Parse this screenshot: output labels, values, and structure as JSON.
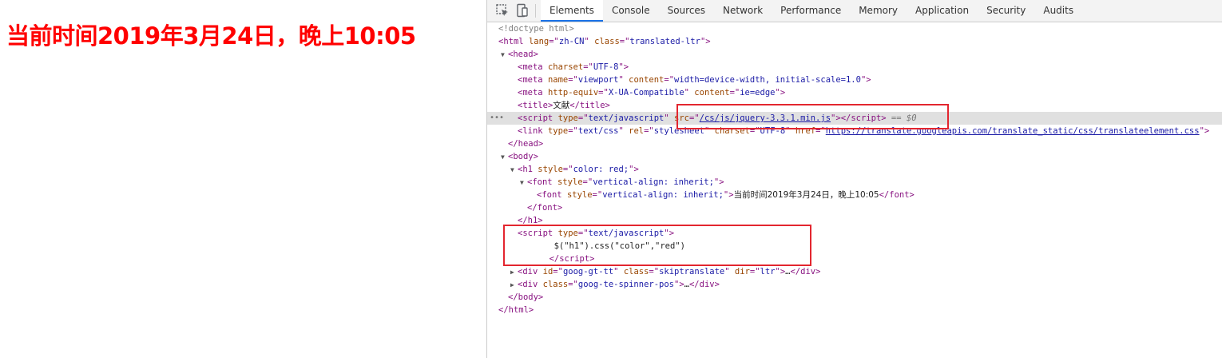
{
  "page": {
    "heading": "当前时间2019年3月24日，晚上10:05",
    "heading_color": "#ff0000"
  },
  "devtools": {
    "toolbar": {
      "inspect_icon": "inspect-element-icon",
      "device_icon": "device-toolbar-icon"
    },
    "tabs": [
      {
        "label": "Elements",
        "active": true
      },
      {
        "label": "Console"
      },
      {
        "label": "Sources"
      },
      {
        "label": "Network"
      },
      {
        "label": "Performance"
      },
      {
        "label": "Memory"
      },
      {
        "label": "Application"
      },
      {
        "label": "Security"
      },
      {
        "label": "Audits"
      }
    ],
    "tree": {
      "doctype": "<!doctype html>",
      "html_open": {
        "tag": "html",
        "attrs": [
          {
            "n": "lang",
            "v": "zh-CN"
          },
          {
            "n": "class",
            "v": "translated-ltr"
          }
        ]
      },
      "head_open": {
        "tag": "head"
      },
      "meta_charset": {
        "tag": "meta",
        "attrs": [
          {
            "n": "charset",
            "v": "UTF-8"
          }
        ]
      },
      "meta_viewport": {
        "tag": "meta",
        "attrs": [
          {
            "n": "name",
            "v": "viewport"
          },
          {
            "n": "content",
            "v": "width=device-width, initial-scale=1.0"
          }
        ]
      },
      "meta_compat": {
        "tag": "meta",
        "attrs": [
          {
            "n": "http-equiv",
            "v": "X-UA-Compatible"
          },
          {
            "n": "content",
            "v": "ie=edge"
          }
        ]
      },
      "title": {
        "tag": "title",
        "text": "文献"
      },
      "script_jquery": {
        "tag": "script",
        "attrs": [
          {
            "n": "type",
            "v": "text/javascript"
          },
          {
            "n": "src",
            "v": "/cs/js/jquery-3.3.1.min.js"
          }
        ],
        "marker": "== $0"
      },
      "link_css": {
        "tag": "link",
        "attrs": [
          {
            "n": "type",
            "v": "text/css"
          },
          {
            "n": "rel",
            "v": "stylesheet"
          },
          {
            "n": "charset",
            "v": "UTF-8"
          },
          {
            "n": "href",
            "v": "https://translate.googleapis.com/translate_static/css/translateelement.css"
          }
        ]
      },
      "head_close": "head",
      "body_open": {
        "tag": "body"
      },
      "h1_open": {
        "tag": "h1",
        "attrs": [
          {
            "n": "style",
            "v": "color: red;"
          }
        ]
      },
      "font_outer": {
        "tag": "font",
        "attrs": [
          {
            "n": "style",
            "v": "vertical-align: inherit;"
          }
        ]
      },
      "font_inner": {
        "tag": "font",
        "attrs": [
          {
            "n": "style",
            "v": "vertical-align: inherit;"
          }
        ],
        "text": "当前时间2019年3月24日，晚上10:05"
      },
      "font_close": "font",
      "h1_close": "h1",
      "script_inline_open": {
        "tag": "script",
        "attrs": [
          {
            "n": "type",
            "v": "text/javascript"
          }
        ]
      },
      "script_inline_code": "$(\"h1\").css(\"color\",\"red\")",
      "script_inline_close": "script",
      "div_gt": {
        "tag": "div",
        "attrs": [
          {
            "n": "id",
            "v": "goog-gt-tt"
          },
          {
            "n": "class",
            "v": "skiptranslate"
          },
          {
            "n": "dir",
            "v": "ltr"
          }
        ],
        "ellipsis": "…"
      },
      "div_spinner": {
        "tag": "div",
        "attrs": [
          {
            "n": "class",
            "v": "goog-te-spinner-pos"
          }
        ],
        "ellipsis": "…"
      },
      "body_close": "body",
      "html_close": "html"
    },
    "highlight_color": "#e3262f"
  }
}
